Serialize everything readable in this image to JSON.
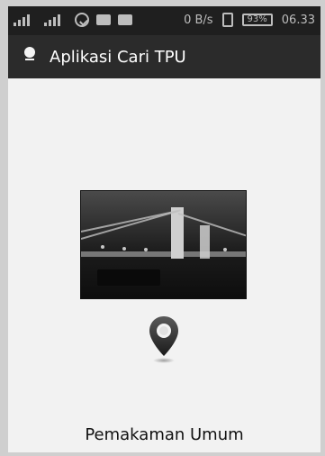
{
  "status_bar": {
    "speed": "0 B/s",
    "battery": "93%",
    "time": "06.33"
  },
  "action_bar": {
    "title": "Aplikasi Cari TPU"
  },
  "main": {
    "image_subject": "bridge at dusk (photo)",
    "pin_icon": "location-pin-icon",
    "caption": "Pemakaman Umum"
  },
  "colors": {
    "statusbar_bg": "#1f1f1f",
    "actionbar_bg": "#2b2b2b",
    "content_bg": "#f2f2f2"
  }
}
